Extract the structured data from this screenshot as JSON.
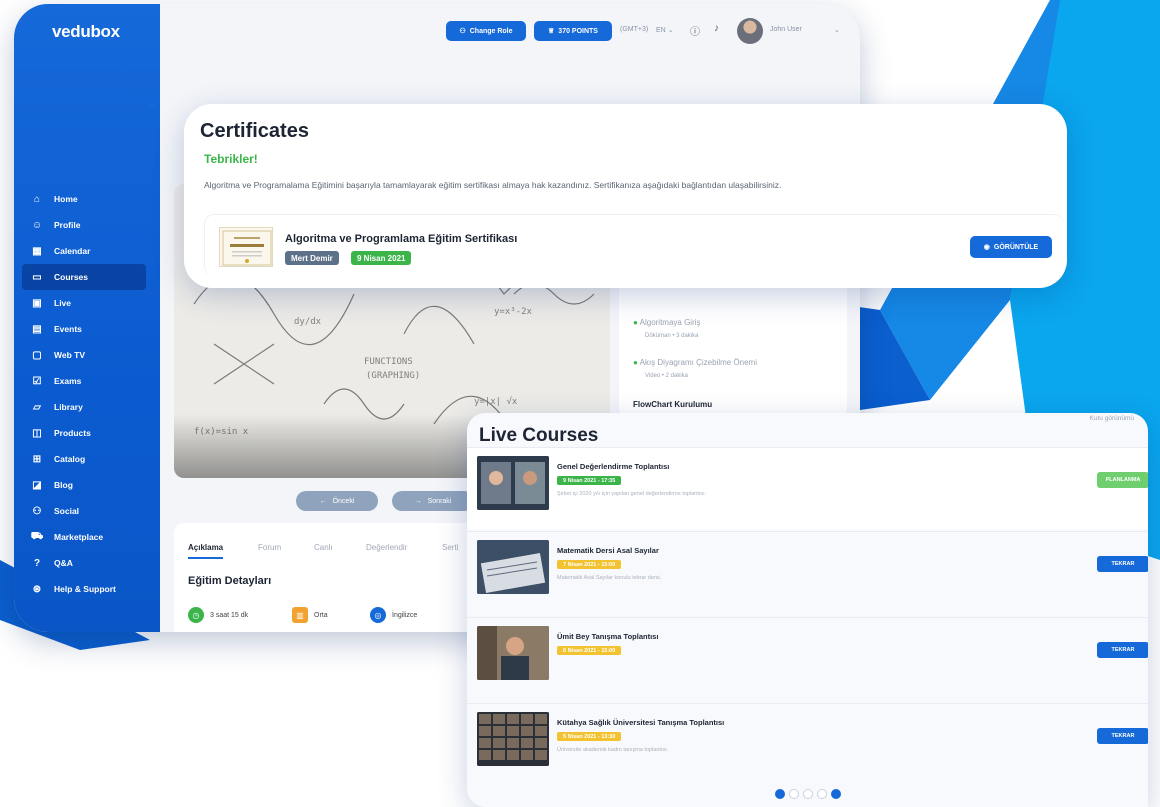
{
  "brand": {
    "name": "vedubox",
    "accent": "#1669d9",
    "green": "#3bb54a",
    "yellow": "#f2c230"
  },
  "topbar": {
    "change_role": "Change Role",
    "points": "370 POINTS",
    "timezone": "(GMT+3)",
    "language": "EN",
    "user_name": "John User"
  },
  "sidebar": {
    "items": [
      {
        "label": "Home",
        "icon": "home-icon"
      },
      {
        "label": "Profile",
        "icon": "user-icon"
      },
      {
        "label": "Calendar",
        "icon": "calendar-icon"
      },
      {
        "label": "Courses",
        "icon": "courses-icon"
      },
      {
        "label": "Live",
        "icon": "live-icon"
      },
      {
        "label": "Events",
        "icon": "events-icon"
      },
      {
        "label": "Web TV",
        "icon": "tv-icon"
      },
      {
        "label": "Exams",
        "icon": "exam-icon"
      },
      {
        "label": "Library",
        "icon": "folder-icon"
      },
      {
        "label": "Products",
        "icon": "basket-icon"
      },
      {
        "label": "Catalog",
        "icon": "grid-icon"
      },
      {
        "label": "Blog",
        "icon": "blog-icon"
      },
      {
        "label": "Social",
        "icon": "social-icon"
      },
      {
        "label": "Marketplace",
        "icon": "cart-icon"
      },
      {
        "label": "Q&A",
        "icon": "question-icon"
      },
      {
        "label": "Help & Support",
        "icon": "help-icon"
      }
    ],
    "active": "Courses"
  },
  "course": {
    "prev": "Önceki",
    "next": "Sonraki",
    "right_items": [
      {
        "title": "Algoritmaya Giriş",
        "meta": "Döküman • 3 dakika"
      },
      {
        "title": "Akış Diyagramı Çizebilme Önemi",
        "meta": "Video • 2 dakika"
      },
      {
        "title": "FlowChart Kurulumu",
        "meta": ""
      }
    ],
    "tabs": [
      "Açıklama",
      "Forum",
      "Canlı",
      "Değerlendir",
      "Serti"
    ],
    "details_title": "Eğitim Detayları",
    "details": [
      {
        "label": "3 saat 15 dk",
        "icon": "clock-icon"
      },
      {
        "label": "Orta",
        "icon": "level-icon"
      },
      {
        "label": "İngilizce",
        "icon": "language-icon"
      }
    ]
  },
  "certificates": {
    "title": "Certificates",
    "congrats": "Tebrikler!",
    "description": "Algoritma ve Programalama Eğitimini başarıyla tamamlayarak eğitim sertifikası almaya hak kazandınız. Sertifikanıza aşağıdaki bağlantıdan ulaşabilirsiniz.",
    "item": {
      "name": "Algoritma ve Programlama Eğitim Sertifikası",
      "person": "Mert Demir",
      "date": "9 Nisan 2021",
      "button": "GÖRÜNTÜLE"
    }
  },
  "live_courses": {
    "title": "Live Courses",
    "empty_label": "Kutu görünümü",
    "items": [
      {
        "title": "Genel Değerlendirme Toplantısı",
        "date": "9 Nisan 2021 - 17:35",
        "desc": "Şirket içi 2020 yılı için yapılan genel değerlendirme toplantısı.",
        "action": "PLANLANMA",
        "color": "#3bb54a"
      },
      {
        "title": "Matematik Dersi Asal Sayılar",
        "date": "7 Nisan 2021 - 15:00",
        "desc": "Matematik Asal Sayılar konulu tekrar dersi.",
        "action": "TEKRAR",
        "color": "#f2c230"
      },
      {
        "title": "Ümit Bey Tanışma Toplantısı",
        "date": "6 Nisan 2021 - 15:00",
        "desc": "",
        "action": "TEKRAR",
        "color": "#f2c230"
      },
      {
        "title": "Kütahya Sağlık Üniversitesi Tanışma Toplantısı",
        "date": "5 Nisan 2021 - 13:30",
        "desc": "Üniversite akademik kadro tanışma toplantısı.",
        "action": "TEKRAR",
        "color": "#f2c230"
      }
    ]
  }
}
